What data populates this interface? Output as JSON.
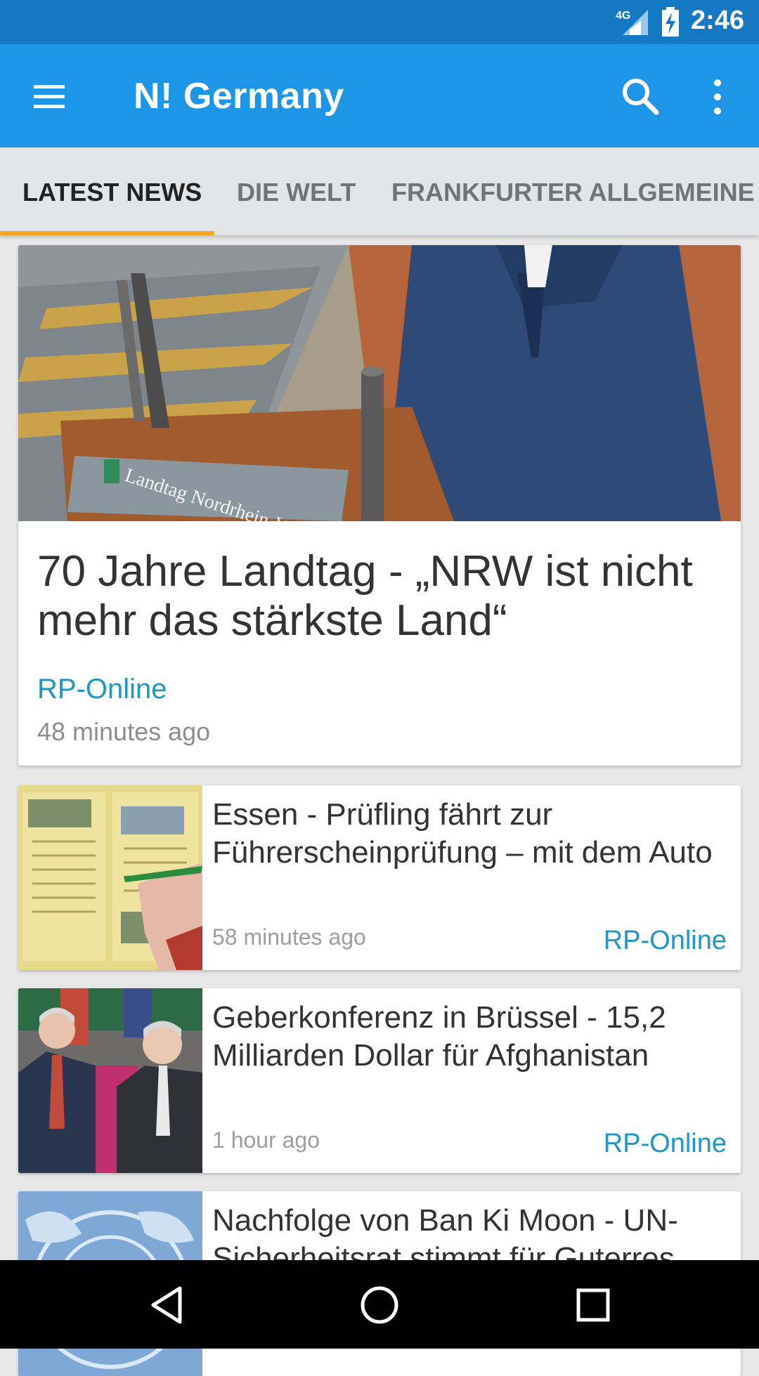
{
  "status_bar": {
    "network": "4G",
    "time": "2:46"
  },
  "app_bar": {
    "title": "N! Germany"
  },
  "tabs": [
    {
      "label": "LATEST NEWS",
      "active": true
    },
    {
      "label": "DIE WELT",
      "active": false
    },
    {
      "label": "FRANKFURTER ALLGEMEINE",
      "active": false
    }
  ],
  "hero": {
    "title": "70 Jahre Landtag - „NRW ist nicht mehr das stärkste Land“",
    "source": "RP-Online",
    "time": "48 minutes ago",
    "image_sign_text": "Landtag Nordrhein-Westf"
  },
  "articles": [
    {
      "title": "Essen - Prüfling fährt zur Führerscheinprüfung – mit dem Auto",
      "time": "58 minutes ago",
      "source": "RP-Online"
    },
    {
      "title": "Geberkonferenz in Brüssel - 15,2 Milliarden Dollar für Afghanistan",
      "time": "1 hour ago",
      "source": "RP-Online"
    },
    {
      "title": "Nachfolge von Ban Ki Moon - UN-Sicherheitsrat stimmt für Guterres",
      "time": "",
      "source": ""
    }
  ],
  "icons": {
    "menu": "menu-icon",
    "search": "search-icon",
    "more": "more-vert-icon",
    "back": "back-icon",
    "home": "home-icon",
    "recents": "recents-icon"
  },
  "colors": {
    "status_bar": "#1478c5",
    "app_bar": "#1e96e8",
    "tab_bg": "#e2e5e8",
    "tab_indicator": "#f5a623",
    "source_link": "#1e97c3"
  }
}
